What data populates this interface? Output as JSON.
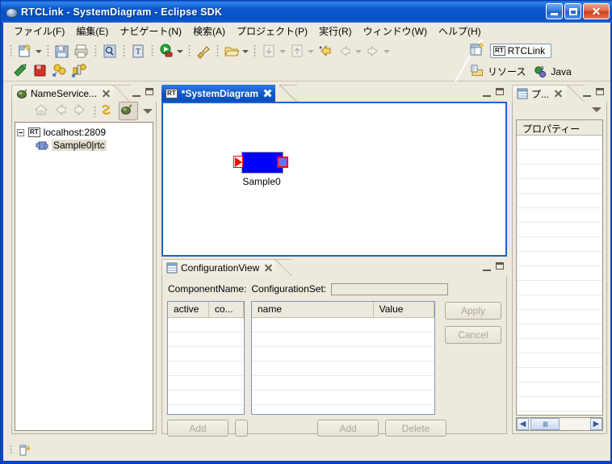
{
  "window": {
    "title": "RTCLink - SystemDiagram - Eclipse SDK",
    "minimize_label": "Minimize",
    "maximize_label": "Maximize",
    "close_label": "Close",
    "titlebar_color": "#0B51C6"
  },
  "menubar": {
    "items": [
      {
        "label": "ファイル(F)",
        "name": "menu-file"
      },
      {
        "label": "編集(E)",
        "name": "menu-edit"
      },
      {
        "label": "ナビゲート(N)",
        "name": "menu-navigate"
      },
      {
        "label": "検索(A)",
        "name": "menu-search"
      },
      {
        "label": "プロジェクト(P)",
        "name": "menu-project"
      },
      {
        "label": "実行(R)",
        "name": "menu-run"
      },
      {
        "label": "ウィンドウ(W)",
        "name": "menu-window"
      },
      {
        "label": "ヘルプ(H)",
        "name": "menu-help"
      }
    ]
  },
  "toolbar": {
    "row1_icons": [
      "new-wizard-icon",
      "save-icon",
      "print-icon",
      "search-icon",
      "new-text-file-icon",
      "run-icon",
      "debug-icon",
      "open-folder-icon",
      "import-icon",
      "export-icon"
    ],
    "row2_icons": [
      "run-rtc-icon",
      "stop-rtc-icon",
      "activate-icon",
      "reset-icon"
    ],
    "nav_icons": [
      "last-edit-location-icon",
      "back-icon",
      "forward-icon"
    ],
    "perspective": {
      "open_perspective_icon": "open-perspective-icon",
      "active_label": "RTCLink",
      "active_badge": "RT",
      "others": [
        {
          "label": "リソース",
          "icon": "resource-perspective-icon"
        },
        {
          "label": "Java",
          "icon": "java-perspective-icon"
        }
      ]
    }
  },
  "name_service_view": {
    "tab_label": "NameService...",
    "tab_icon": "name-service-icon",
    "toolbar_icons": [
      "home-icon",
      "back-icon",
      "forward-icon",
      "refresh-icon",
      "connect-icon",
      "view-menu-icon"
    ],
    "minimize_label": "Minimize",
    "maximize_label": "Maximize",
    "tree": {
      "root": {
        "label": "localhost:2809",
        "badge": "RT",
        "expanded": true
      },
      "children": [
        {
          "label": "Sample0|rtc",
          "icon": "rtc-node-icon",
          "selected": true
        }
      ]
    }
  },
  "editor": {
    "tab_label": "*SystemDiagram",
    "tab_badge": "RT",
    "dirty": true,
    "minimize_label": "Minimize",
    "maximize_label": "Maximize",
    "component": {
      "name": "Sample0",
      "body_color": "#0000FF",
      "port_border_color": "#FF0000",
      "input_port": "in-port",
      "output_port": "out-port"
    }
  },
  "configuration_view": {
    "tab_label": "ConfigurationView",
    "tab_icon": "table-icon",
    "minimize_label": "Minimize",
    "maximize_label": "Maximize",
    "component_name_label": "ComponentName:",
    "component_name_value": "",
    "configuration_set_label": "ConfigurationSet:",
    "configuration_set_value": "",
    "set_table": {
      "columns": [
        "active",
        "co..."
      ],
      "rows": []
    },
    "param_table": {
      "columns": [
        "name",
        "Value"
      ],
      "rows": []
    },
    "buttons": {
      "apply": "Apply",
      "cancel": "Cancel",
      "add_set": "Add",
      "blank": "",
      "add_param": "Add",
      "delete_param": "Delete"
    }
  },
  "properties_view": {
    "tab_label": "プ...",
    "tab_icon": "properties-icon",
    "view_menu_icon": "view-menu-icon",
    "minimize_label": "Minimize",
    "maximize_label": "Maximize",
    "column_header": "プロパティー",
    "rows": [],
    "scrollbar": {
      "left": "◀",
      "right": "▶"
    }
  },
  "statusbar": {
    "icon": "editor-status-icon",
    "text": ""
  }
}
